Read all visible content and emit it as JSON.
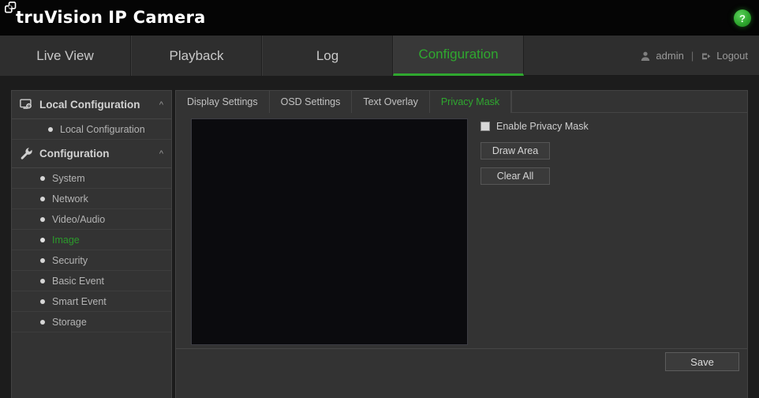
{
  "header": {
    "brand_name": "truVision",
    "brand_product": "IP Camera",
    "logo_icon": "stacked-squares-icon",
    "help_icon": "question-mark-icon",
    "help_label": "?"
  },
  "nav": {
    "tabs": [
      {
        "label": "Live View",
        "active": false
      },
      {
        "label": "Playback",
        "active": false
      },
      {
        "label": "Log",
        "active": false
      },
      {
        "label": "Configuration",
        "active": true
      }
    ],
    "user": {
      "user_icon": "person-icon",
      "username": "admin",
      "divider": "|",
      "logout_icon": "logout-arrow-icon",
      "logout_label": "Logout"
    }
  },
  "sidebar": {
    "groups": [
      {
        "label": "Local Configuration",
        "icon": "monitor-gear-icon",
        "chevron": "^",
        "items": [
          {
            "label": "Local Configuration",
            "active": false
          }
        ]
      },
      {
        "label": "Configuration",
        "icon": "wrench-icon",
        "chevron": "^",
        "items": [
          {
            "label": "System",
            "active": false
          },
          {
            "label": "Network",
            "active": false
          },
          {
            "label": "Video/Audio",
            "active": false
          },
          {
            "label": "Image",
            "active": true
          },
          {
            "label": "Security",
            "active": false
          },
          {
            "label": "Basic Event",
            "active": false
          },
          {
            "label": "Smart Event",
            "active": false
          },
          {
            "label": "Storage",
            "active": false
          }
        ]
      }
    ]
  },
  "content": {
    "tabs": [
      {
        "label": "Display Settings",
        "active": false
      },
      {
        "label": "OSD Settings",
        "active": false
      },
      {
        "label": "Text Overlay",
        "active": false
      },
      {
        "label": "Privacy Mask",
        "active": true
      }
    ],
    "video_preview": {
      "name": "live-video-preview",
      "content": ""
    },
    "controls": {
      "enable_checkbox_label": "Enable Privacy Mask",
      "enable_checked": false,
      "draw_area_label": "Draw Area",
      "clear_all_label": "Clear All"
    },
    "footer": {
      "save_label": "Save"
    }
  },
  "colors": {
    "accent_green": "#2fa82f",
    "panel_bg": "#333333",
    "page_bg": "#1c1c1c",
    "header_bg": "#050505",
    "video_bg": "#0b0b0e"
  }
}
